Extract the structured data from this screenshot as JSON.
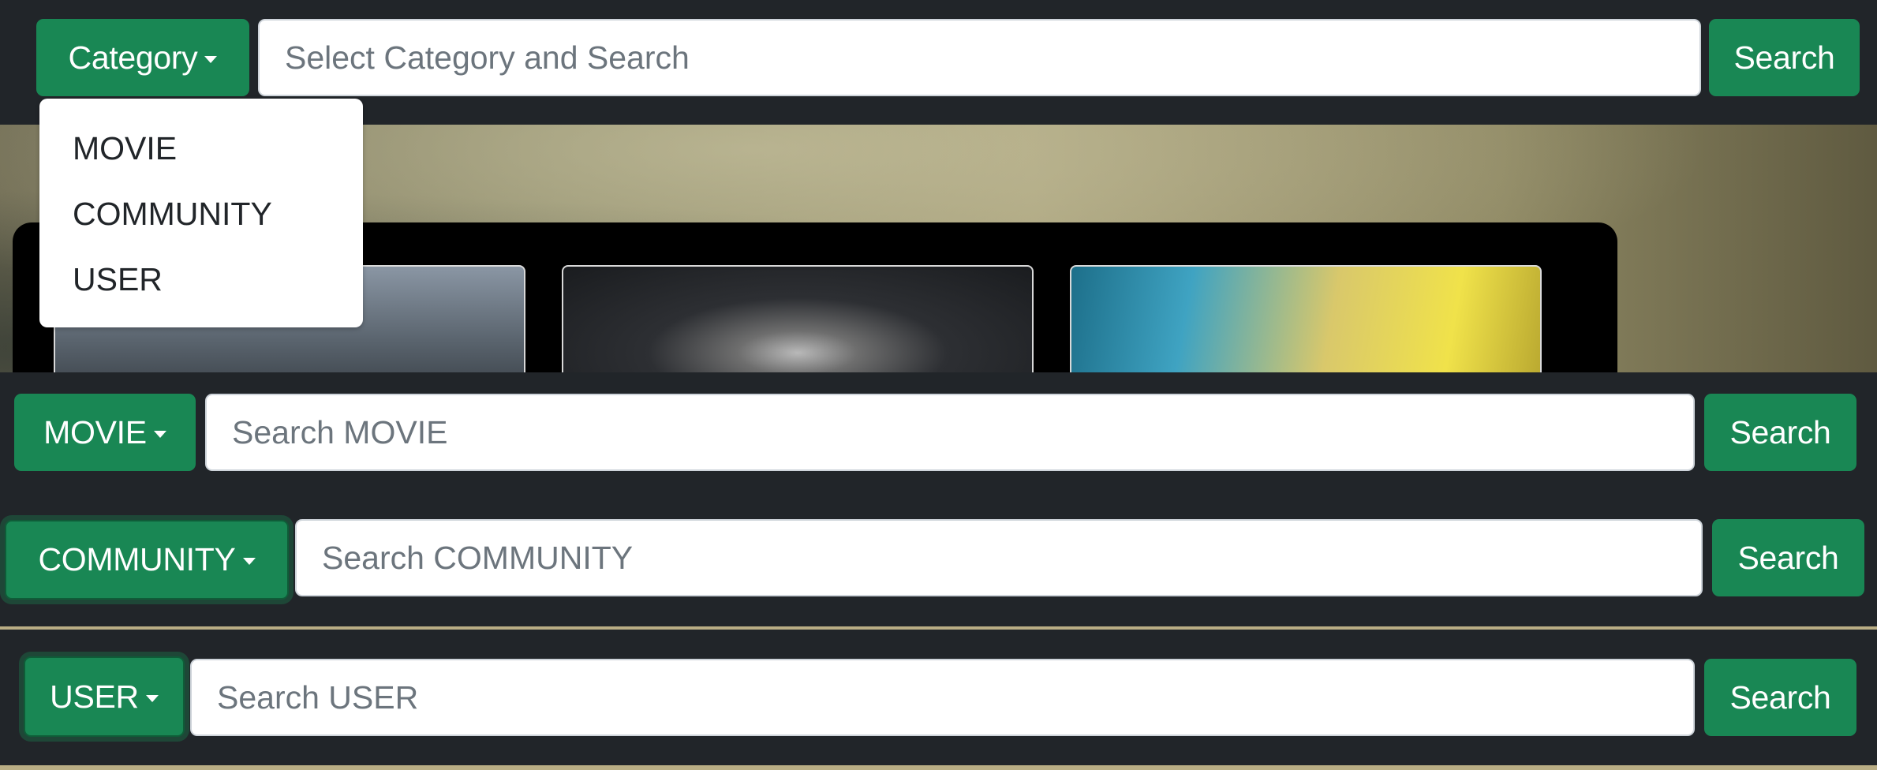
{
  "bars": [
    {
      "button_label": "Category",
      "input_placeholder": "Select Category and Search",
      "search_label": "Search"
    },
    {
      "button_label": "MOVIE",
      "input_placeholder": "Search MOVIE",
      "search_label": "Search"
    },
    {
      "button_label": "COMMUNITY",
      "input_placeholder": "Search COMMUNITY",
      "search_label": "Search"
    },
    {
      "button_label": "USER",
      "input_placeholder": "Search USER",
      "search_label": "Search"
    }
  ],
  "dropdown": {
    "items": [
      "MOVIE",
      "COMMUNITY",
      "USER"
    ]
  },
  "colors": {
    "background": "#212529",
    "accent": "#198754",
    "input_bg": "#ffffff"
  },
  "icons": {
    "caret": "caret-down-icon"
  }
}
